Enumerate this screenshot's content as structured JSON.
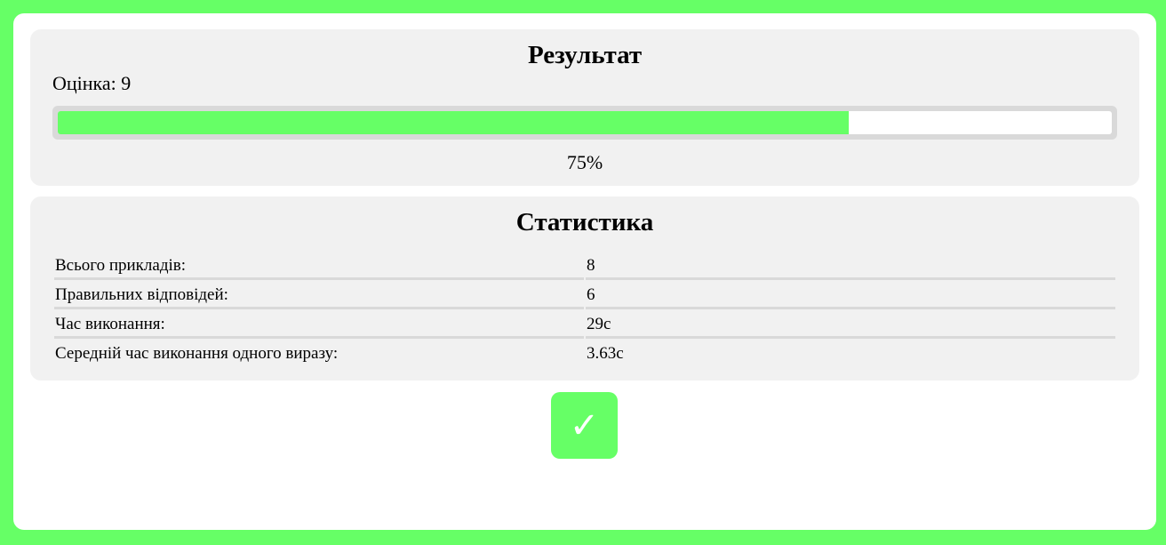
{
  "result": {
    "title": "Результат",
    "grade_label": "Оцінка: 9",
    "progress_fraction": 0.75,
    "percent_text": "75%"
  },
  "stats": {
    "title": "Статистика",
    "rows": [
      {
        "label": "Всього прикладів:",
        "value": "8"
      },
      {
        "label": "Правильних відповідей:",
        "value": "6"
      },
      {
        "label": "Час виконання:",
        "value": "29с"
      },
      {
        "label": "Середній час виконання одного виразу:",
        "value": "3.63с"
      }
    ]
  },
  "ok_button": {
    "label": "✓",
    "icon": "checkmark-icon"
  },
  "colors": {
    "accent": "#66ff66",
    "panel": "#f1f1f1",
    "track": "#d9d9d9"
  }
}
